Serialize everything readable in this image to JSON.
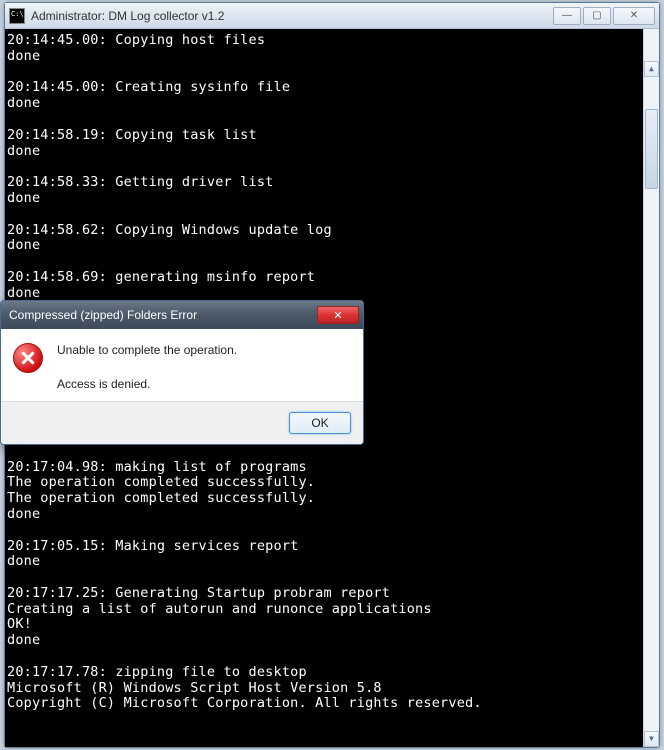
{
  "console": {
    "title": "Administrator:  DM Log collector v1.2",
    "lines": [
      "20:14:45.00: Copying host files",
      "done",
      "",
      "20:14:45.00: Creating sysinfo file",
      "done",
      "",
      "20:14:58.19: Copying task list",
      "done",
      "",
      "20:14:58.33: Getting driver list",
      "done",
      "",
      "20:14:58.62: Copying Windows update log",
      "done",
      "",
      "20:14:58.69: generating msinfo report",
      "done",
      "",
      "",
      "",
      "",
      "",
      "",
      "",
      "",
      "",
      "",
      "20:17:04.98: making list of programs",
      "The operation completed successfully.",
      "The operation completed successfully.",
      "done",
      "",
      "20:17:05.15: Making services report",
      "done",
      "",
      "20:17:17.25: Generating Startup probram report",
      "Creating a list of autorun and runonce applications",
      "OK!",
      "done",
      "",
      "20:17:17.78: zipping file to desktop",
      "Microsoft (R) Windows Script Host Version 5.8",
      "Copyright (C) Microsoft Corporation. All rights reserved."
    ]
  },
  "dialog": {
    "title": "Compressed (zipped) Folders Error",
    "message_line1": "Unable to complete the operation.",
    "message_line2": "Access is denied.",
    "ok_label": "OK"
  },
  "win_controls": {
    "minimize": "—",
    "maximize": "▢",
    "close": "✕"
  }
}
